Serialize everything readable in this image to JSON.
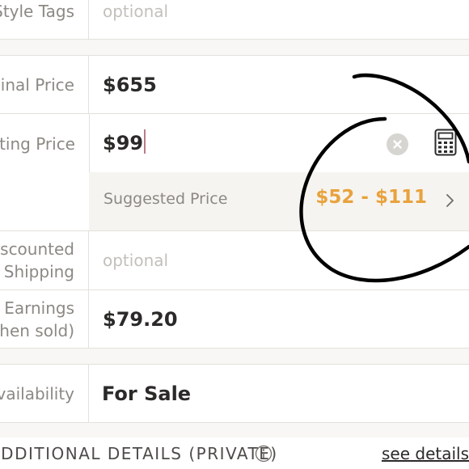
{
  "rows": {
    "style_tags": {
      "label": "Style Tags",
      "placeholder": "optional"
    },
    "original_price": {
      "label": "Original Price",
      "value": "$655"
    },
    "listing_price": {
      "label": "Listing Price",
      "value": "$99"
    },
    "suggested_price": {
      "label": "Suggested Price",
      "range": "$52 - $111"
    },
    "discounted_shipping": {
      "label_line1": "Discounted",
      "label_line2": "Shipping",
      "placeholder": "optional"
    },
    "earnings": {
      "label_line1": "Earnings",
      "label_line2": "(when sold)",
      "value": "$79.20"
    },
    "availability": {
      "label": "Availability",
      "value": "For Sale"
    }
  },
  "additional": {
    "title": "ADDITIONAL DETAILS (PRIVATE)",
    "link": "see details"
  },
  "icons": {
    "clear": "clear-circle-icon",
    "calculator": "calculator-icon",
    "chevron": "chevron-right-icon",
    "info": "info-icon"
  },
  "colors": {
    "accent_orange": "#e8a23d",
    "label_gray": "#8c8984",
    "value_dark": "#2b2a29",
    "caret": "#b97c86",
    "annotation_ink": "#000000"
  }
}
